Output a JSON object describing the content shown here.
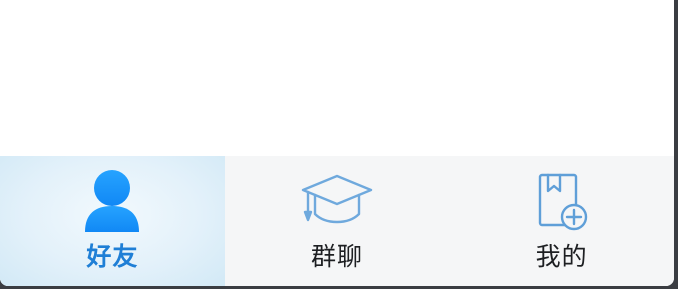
{
  "tabs": [
    {
      "label": "好友",
      "icon": "person-icon",
      "active": true
    },
    {
      "label": "群聊",
      "icon": "graduation-cap-icon",
      "active": false
    },
    {
      "label": "我的",
      "icon": "book-add-icon",
      "active": false
    }
  ],
  "colors": {
    "accent": "#1f7fd6",
    "active_icon": "#1a8cf0",
    "inactive_icon": "#6fa9dd",
    "tabbar_bg": "#f5f6f7",
    "active_tab_bg": "#e3f1fa"
  }
}
